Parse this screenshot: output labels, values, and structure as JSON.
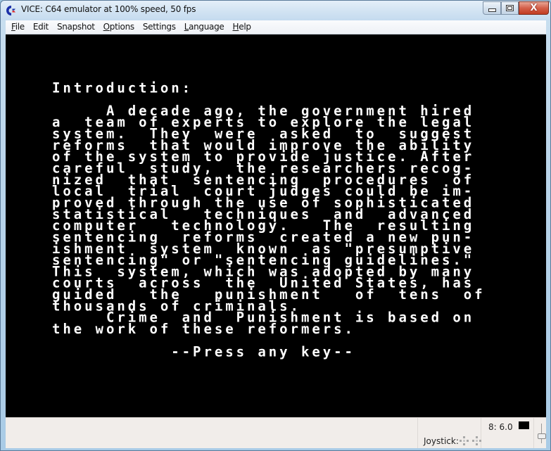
{
  "window": {
    "title": "VICE: C64 emulator at 100% speed, 50 fps",
    "icon": "commodore-logo-icon",
    "controls": {
      "minimize": "minimize-icon",
      "maximize": "maximize-icon",
      "close": "close-icon",
      "close_glyph": "X"
    }
  },
  "menubar": {
    "items": [
      {
        "label": "File",
        "mnemonic": "F",
        "rest": "ile"
      },
      {
        "label": "Edit",
        "mnemonic": "",
        "rest": "Edit"
      },
      {
        "label": "Snapshot",
        "mnemonic": "",
        "rest": "Snapshot"
      },
      {
        "label": "Options",
        "mnemonic": "O",
        "rest": "ptions"
      },
      {
        "label": "Settings",
        "mnemonic": "",
        "rest": "Settings"
      },
      {
        "label": "Language",
        "mnemonic": "L",
        "rest": "anguage"
      },
      {
        "label": "Help",
        "mnemonic": "H",
        "rest": "elp"
      }
    ]
  },
  "screen": {
    "lines": [
      "Introduction:",
      "",
      "     A decade ago, the government hired",
      "a  team of experts to explore the legal",
      "system.  They  were  asked  to  suggest",
      "reforms  that would improve the ability",
      "of the system to provide justice. After",
      "careful  study,  the researchers recog-",
      "nized  that  sentencing  procedures  of",
      "local  trial  court judges could be im-",
      "proved through the use of sophisticated",
      "statistical   techniques  and  advanced",
      "computer   technology.   The  resulting",
      "sentencing  reforms  created a new pun-",
      "ishment  system  known  as \"presumptive",
      "sentencing\" or \"sentencing guidelines.\"",
      "This  system, which was adopted by many",
      "courts  across  the  United States, has",
      "guided   the   punishment   of  tens  of",
      "thousands of criminals.",
      "     Crime  and  Punishment is based on",
      "the work of these reformers.",
      "",
      "           --Press any key--"
    ],
    "background": "#000000",
    "foreground": "#ffffff"
  },
  "statusbar": {
    "joystick_label": "Joystick:",
    "drive_status": "8: 6.0",
    "drive_led_color": "#000000"
  }
}
